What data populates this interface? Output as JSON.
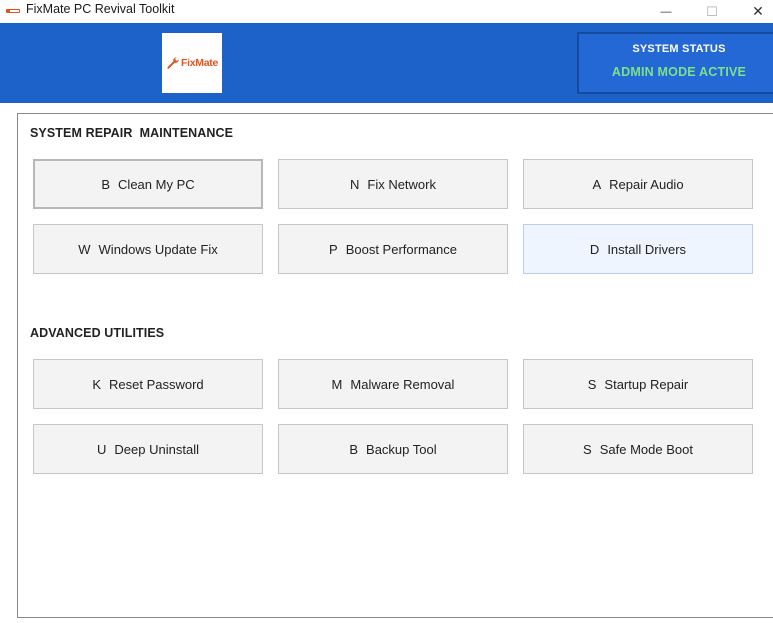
{
  "window": {
    "title": "FixMate PC Revival Toolkit",
    "minimize_glyph": "—",
    "maximize_glyph": "☐",
    "close_glyph": "✕"
  },
  "header": {
    "logo_text": "FixMate",
    "background_color": "#1d62c9",
    "status": {
      "title": "SYSTEM STATUS",
      "value": "ADMIN MODE ACTIVE",
      "value_color": "#7ee08a"
    }
  },
  "sections": [
    {
      "title": "SYSTEM REPAIR  MAINTENANCE",
      "buttons": [
        {
          "key": "B",
          "label": "Clean My PC"
        },
        {
          "key": "N",
          "label": "Fix Network"
        },
        {
          "key": "A",
          "label": "Repair Audio"
        },
        {
          "key": "W",
          "label": "Windows Update Fix"
        },
        {
          "key": "P",
          "label": "Boost Performance"
        },
        {
          "key": "D",
          "label": "Install Drivers"
        }
      ]
    },
    {
      "title": "ADVANCED UTILITIES",
      "buttons": [
        {
          "key": "K",
          "label": "Reset Password"
        },
        {
          "key": "M",
          "label": "Malware Removal"
        },
        {
          "key": "S",
          "label": "Startup Repair"
        },
        {
          "key": "U",
          "label": "Deep Uninstall"
        },
        {
          "key": "B",
          "label": "Backup Tool"
        },
        {
          "key": "S",
          "label": "Safe Mode Boot"
        }
      ]
    }
  ],
  "icons": {
    "app": "fixmate-app-icon",
    "logo": "wrench-icon"
  }
}
